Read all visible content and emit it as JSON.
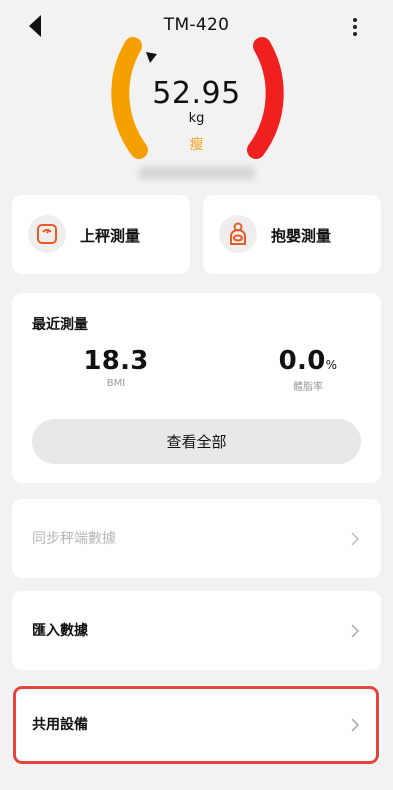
{
  "header": {
    "title": "TM-420"
  },
  "measurement": {
    "weight": "52.95",
    "unit": "kg",
    "status": "瘦",
    "status_color": "#f5a623"
  },
  "actions": [
    {
      "label": "上秤測量",
      "icon": "scale-icon"
    },
    {
      "label": "抱嬰測量",
      "icon": "baby-hold-icon"
    }
  ],
  "recent": {
    "title": "最近測量",
    "bmi_value": "18.3",
    "bmi_label": "BMI",
    "fat_value": "0.0",
    "fat_suffix": "%",
    "fat_label": "體脂率",
    "view_all": "查看全部"
  },
  "menu": [
    {
      "label": "同步秤端數據",
      "enabled": false
    },
    {
      "label": "匯入數據",
      "enabled": true
    },
    {
      "label": "共用設備",
      "enabled": true,
      "highlighted": true
    }
  ],
  "colors": {
    "gauge_left": "#f5a000",
    "gauge_right": "#f0201e",
    "highlight": "#e8433a",
    "accent": "#e85a2a"
  }
}
